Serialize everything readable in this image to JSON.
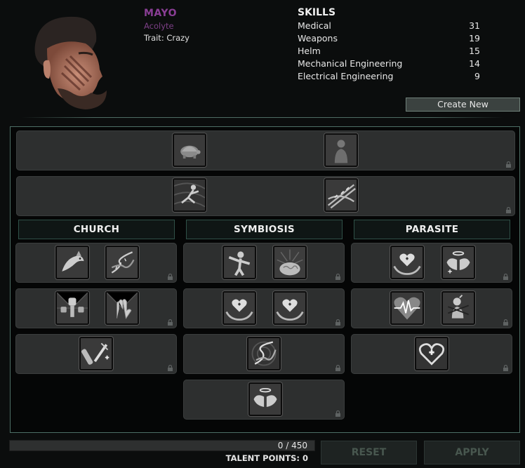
{
  "character": {
    "name": "MAYO",
    "job": "Acolyte",
    "trait": "Trait: Crazy"
  },
  "skills": {
    "title": "SKILLS",
    "items": [
      {
        "name": "Medical",
        "value": "31"
      },
      {
        "name": "Weapons",
        "value": "19"
      },
      {
        "name": "Helm",
        "value": "15"
      },
      {
        "name": "Mechanical Engineering",
        "value": "14"
      },
      {
        "name": "Electrical Engineering",
        "value": "9"
      }
    ]
  },
  "create_button": "Create New",
  "branches": {
    "church": "CHURCH",
    "symbiosis": "SYMBIOSIS",
    "parasite": "PARASITE"
  },
  "talent_icons": {
    "base_row1": [
      "turtle-icon",
      "human-silhouette-icon"
    ],
    "base_row2": [
      "leaping-figure-icon",
      "tangled-vines-icon"
    ],
    "church": [
      [
        "fish-creature-icon",
        "dna-strand-icon"
      ],
      [
        "raised-fists-icon",
        "open-hand-icon"
      ],
      [
        "syringe-vial-icon"
      ]
    ],
    "symbiosis": [
      [
        "muscular-figure-icon",
        "brain-icon"
      ],
      [
        "heart-hands-icon",
        "heart-hands-icon"
      ],
      [
        "dna-swirl-icon"
      ],
      [
        "winged-halo-icon"
      ]
    ],
    "parasite": [
      [
        "heart-hands-icon",
        "winged-halo-icon"
      ],
      [
        "heartbeat-icon",
        "bound-creature-icon"
      ],
      [
        "heart-cross-icon"
      ]
    ]
  },
  "progress": {
    "text": "0 / 450",
    "fraction": 0.0
  },
  "talent_points": "TALENT POINTS: 0",
  "buttons": {
    "reset": "RESET",
    "apply": "APPLY"
  },
  "colors": {
    "name": "#8a3e95",
    "accent_border": "#4d6f66",
    "panel_bg": "#2d2f2f"
  }
}
